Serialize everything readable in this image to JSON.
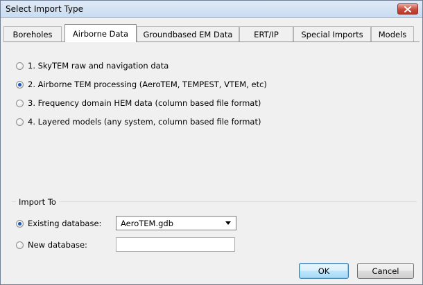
{
  "window": {
    "title": "Select Import Type"
  },
  "tabs": [
    {
      "label": "Boreholes",
      "active": false
    },
    {
      "label": "Airborne Data",
      "active": true
    },
    {
      "label": "Groundbased EM Data",
      "active": false
    },
    {
      "label": "ERT/IP",
      "active": false
    },
    {
      "label": "Special Imports",
      "active": false
    },
    {
      "label": "Models",
      "active": false
    }
  ],
  "import_options": [
    {
      "label": "1. SkyTEM raw and navigation data",
      "selected": false
    },
    {
      "label": "2. Airborne TEM processing (AeroTEM, TEMPEST, VTEM, etc)",
      "selected": true
    },
    {
      "label": "3. Frequency domain HEM data (column based file format)",
      "selected": false
    },
    {
      "label": "4. Layered models (any system, column based file format)",
      "selected": false
    }
  ],
  "import_to": {
    "group_label": "Import To",
    "existing_label": "Existing database:",
    "existing_selected": true,
    "existing_value": "AeroTEM.gdb",
    "new_label": "New database:",
    "new_value": ""
  },
  "buttons": {
    "ok": "OK",
    "cancel": "Cancel"
  },
  "colors": {
    "accent": "#1a59b7",
    "close": "#c84b3c"
  }
}
